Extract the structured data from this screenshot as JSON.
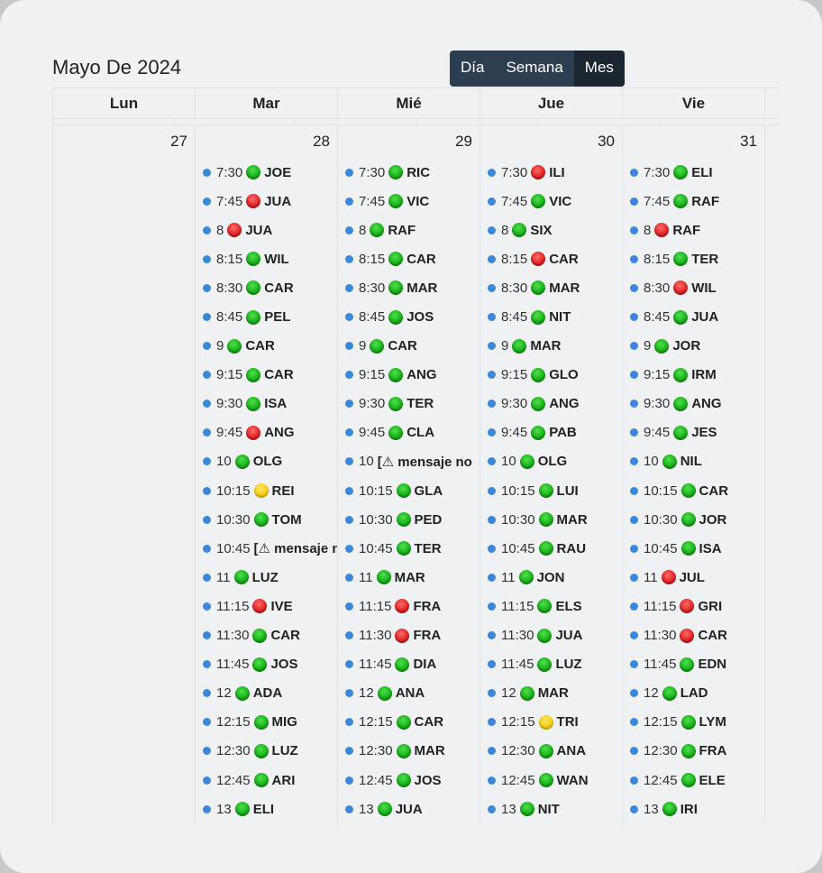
{
  "header": {
    "title": "Mayo De 2024",
    "views": [
      {
        "label": "Día",
        "active": false
      },
      {
        "label": "Semana",
        "active": false
      },
      {
        "label": "Mes",
        "active": true
      }
    ]
  },
  "colors": {
    "event_dot": "#3a87dd",
    "switch_bg": "#2c3e50",
    "switch_active": "#1b2631",
    "status_green": "#18b018",
    "status_red": "#e02424",
    "status_yellow": "#f8cc10"
  },
  "weekdays": [
    "Lun",
    "Mar",
    "Mié",
    "Jue",
    "Vie"
  ],
  "days": [
    {
      "number": "27",
      "events": []
    },
    {
      "number": "28",
      "events": [
        {
          "time": "7:30",
          "status": "green",
          "name": "JOE"
        },
        {
          "time": "7:45",
          "status": "red",
          "name": "JUA"
        },
        {
          "time": "8",
          "status": "red",
          "name": "JUA"
        },
        {
          "time": "8:15",
          "status": "green",
          "name": "WIL"
        },
        {
          "time": "8:30",
          "status": "green",
          "name": "CAR"
        },
        {
          "time": "8:45",
          "status": "green",
          "name": "PEL"
        },
        {
          "time": "9",
          "status": "green",
          "name": "CAR"
        },
        {
          "time": "9:15",
          "status": "green",
          "name": "CAR"
        },
        {
          "time": "9:30",
          "status": "green",
          "name": "ISA"
        },
        {
          "time": "9:45",
          "status": "red",
          "name": "ANG"
        },
        {
          "time": "10",
          "status": "green",
          "name": "OLG"
        },
        {
          "time": "10:15",
          "status": "yellow",
          "name": "REI"
        },
        {
          "time": "10:30",
          "status": "green",
          "name": "TOM"
        },
        {
          "time": "10:45",
          "status": "",
          "name": "[⚠ mensaje no"
        },
        {
          "time": "11",
          "status": "green",
          "name": "LUZ"
        },
        {
          "time": "11:15",
          "status": "red",
          "name": "IVE"
        },
        {
          "time": "11:30",
          "status": "green",
          "name": "CAR"
        },
        {
          "time": "11:45",
          "status": "green",
          "name": "JOS"
        },
        {
          "time": "12",
          "status": "green",
          "name": "ADA"
        },
        {
          "time": "12:15",
          "status": "green",
          "name": "MIG"
        },
        {
          "time": "12:30",
          "status": "green",
          "name": "LUZ"
        },
        {
          "time": "12:45",
          "status": "green",
          "name": "ARI"
        },
        {
          "time": "13",
          "status": "green",
          "name": "ELI"
        }
      ]
    },
    {
      "number": "29",
      "events": [
        {
          "time": "7:30",
          "status": "green",
          "name": "RIC"
        },
        {
          "time": "7:45",
          "status": "green",
          "name": "VIC"
        },
        {
          "time": "8",
          "status": "green",
          "name": "RAF"
        },
        {
          "time": "8:15",
          "status": "green",
          "name": "CAR"
        },
        {
          "time": "8:30",
          "status": "green",
          "name": "MAR"
        },
        {
          "time": "8:45",
          "status": "green",
          "name": "JOS"
        },
        {
          "time": "9",
          "status": "green",
          "name": "CAR"
        },
        {
          "time": "9:15",
          "status": "green",
          "name": "ANG"
        },
        {
          "time": "9:30",
          "status": "green",
          "name": "TER"
        },
        {
          "time": "9:45",
          "status": "green",
          "name": "CLA"
        },
        {
          "time": "10",
          "status": "",
          "name": "[⚠ mensaje no"
        },
        {
          "time": "10:15",
          "status": "green",
          "name": "GLA"
        },
        {
          "time": "10:30",
          "status": "green",
          "name": "PED"
        },
        {
          "time": "10:45",
          "status": "green",
          "name": "TER"
        },
        {
          "time": "11",
          "status": "green",
          "name": "MAR"
        },
        {
          "time": "11:15",
          "status": "red",
          "name": "FRA"
        },
        {
          "time": "11:30",
          "status": "red",
          "name": "FRA"
        },
        {
          "time": "11:45",
          "status": "green",
          "name": "DIA"
        },
        {
          "time": "12",
          "status": "green",
          "name": "ANA"
        },
        {
          "time": "12:15",
          "status": "green",
          "name": "CAR"
        },
        {
          "time": "12:30",
          "status": "green",
          "name": "MAR"
        },
        {
          "time": "12:45",
          "status": "green",
          "name": "JOS"
        },
        {
          "time": "13",
          "status": "green",
          "name": "JUA"
        }
      ]
    },
    {
      "number": "30",
      "events": [
        {
          "time": "7:30",
          "status": "red",
          "name": "ILI"
        },
        {
          "time": "7:45",
          "status": "green",
          "name": "VIC"
        },
        {
          "time": "8",
          "status": "green",
          "name": "SIX"
        },
        {
          "time": "8:15",
          "status": "red",
          "name": "CAR"
        },
        {
          "time": "8:30",
          "status": "green",
          "name": "MAR"
        },
        {
          "time": "8:45",
          "status": "green",
          "name": "NIT"
        },
        {
          "time": "9",
          "status": "green",
          "name": "MAR"
        },
        {
          "time": "9:15",
          "status": "green",
          "name": "GLO"
        },
        {
          "time": "9:30",
          "status": "green",
          "name": "ANG"
        },
        {
          "time": "9:45",
          "status": "green",
          "name": "PAB"
        },
        {
          "time": "10",
          "status": "green",
          "name": "OLG"
        },
        {
          "time": "10:15",
          "status": "green",
          "name": "LUI"
        },
        {
          "time": "10:30",
          "status": "green",
          "name": "MAR"
        },
        {
          "time": "10:45",
          "status": "green",
          "name": "RAU"
        },
        {
          "time": "11",
          "status": "green",
          "name": "JON"
        },
        {
          "time": "11:15",
          "status": "green",
          "name": "ELS"
        },
        {
          "time": "11:30",
          "status": "green",
          "name": "JUA"
        },
        {
          "time": "11:45",
          "status": "green",
          "name": "LUZ"
        },
        {
          "time": "12",
          "status": "green",
          "name": "MAR"
        },
        {
          "time": "12:15",
          "status": "yellow",
          "name": "TRI"
        },
        {
          "time": "12:30",
          "status": "green",
          "name": "ANA"
        },
        {
          "time": "12:45",
          "status": "green",
          "name": "WAN"
        },
        {
          "time": "13",
          "status": "green",
          "name": "NIT"
        }
      ]
    },
    {
      "number": "31",
      "events": [
        {
          "time": "7:30",
          "status": "green",
          "name": "ELI"
        },
        {
          "time": "7:45",
          "status": "green",
          "name": "RAF"
        },
        {
          "time": "8",
          "status": "red",
          "name": "RAF"
        },
        {
          "time": "8:15",
          "status": "green",
          "name": "TER"
        },
        {
          "time": "8:30",
          "status": "red",
          "name": "WIL"
        },
        {
          "time": "8:45",
          "status": "green",
          "name": "JUA"
        },
        {
          "time": "9",
          "status": "green",
          "name": "JOR"
        },
        {
          "time": "9:15",
          "status": "green",
          "name": "IRM"
        },
        {
          "time": "9:30",
          "status": "green",
          "name": "ANG"
        },
        {
          "time": "9:45",
          "status": "green",
          "name": "JES"
        },
        {
          "time": "10",
          "status": "green",
          "name": "NIL"
        },
        {
          "time": "10:15",
          "status": "green",
          "name": "CAR"
        },
        {
          "time": "10:30",
          "status": "green",
          "name": "JOR"
        },
        {
          "time": "10:45",
          "status": "green",
          "name": "ISA"
        },
        {
          "time": "11",
          "status": "red",
          "name": "JUL"
        },
        {
          "time": "11:15",
          "status": "red",
          "name": "GRI"
        },
        {
          "time": "11:30",
          "status": "red",
          "name": "CAR"
        },
        {
          "time": "11:45",
          "status": "green",
          "name": "EDN"
        },
        {
          "time": "12",
          "status": "green",
          "name": "LAD"
        },
        {
          "time": "12:15",
          "status": "green",
          "name": "LYM"
        },
        {
          "time": "12:30",
          "status": "green",
          "name": "FRA"
        },
        {
          "time": "12:45",
          "status": "green",
          "name": "ELE"
        },
        {
          "time": "13",
          "status": "green",
          "name": "IRI"
        }
      ]
    }
  ]
}
